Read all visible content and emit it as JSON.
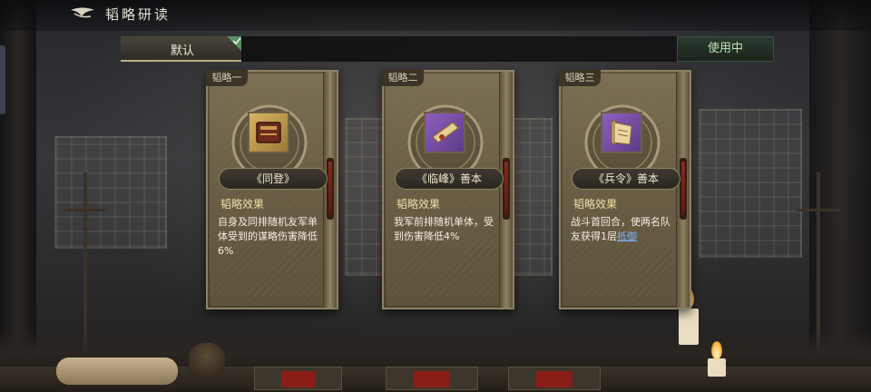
{
  "header": {
    "title": "韬略研读",
    "back_icon": "back-arrow-icon"
  },
  "tabs": {
    "default_label": "默认",
    "default_selected": true,
    "check_icon": "check-icon",
    "in_use_label": "使用中"
  },
  "cards": [
    {
      "slot_label": "韬略一",
      "name": "《同登》",
      "effect_label": "韬略效果",
      "effect_text": "自身及同排随机友军单体受到的谋略伤害降低6%",
      "icon": "book-icon",
      "icon_bg": "#c8a24a"
    },
    {
      "slot_label": "韬略二",
      "name": "《临峰》善本",
      "effect_label": "韬略效果",
      "effect_text": "我军前排随机单体，受到伤害降低4%",
      "icon": "scroll-icon",
      "icon_bg": "#7b4fa8"
    },
    {
      "slot_label": "韬略三",
      "name": "《兵令》善本",
      "effect_label": "韬略效果",
      "effect_text": "战斗首回合，使两名队友获得1层",
      "effect_link": "抵御",
      "icon": "scroll-icon",
      "icon_bg": "#7b4fa8"
    }
  ],
  "colors": {
    "accent_gold": "#f0dfa8",
    "in_use_green": "#bfe4b2",
    "link_blue": "#7fb3ff"
  }
}
